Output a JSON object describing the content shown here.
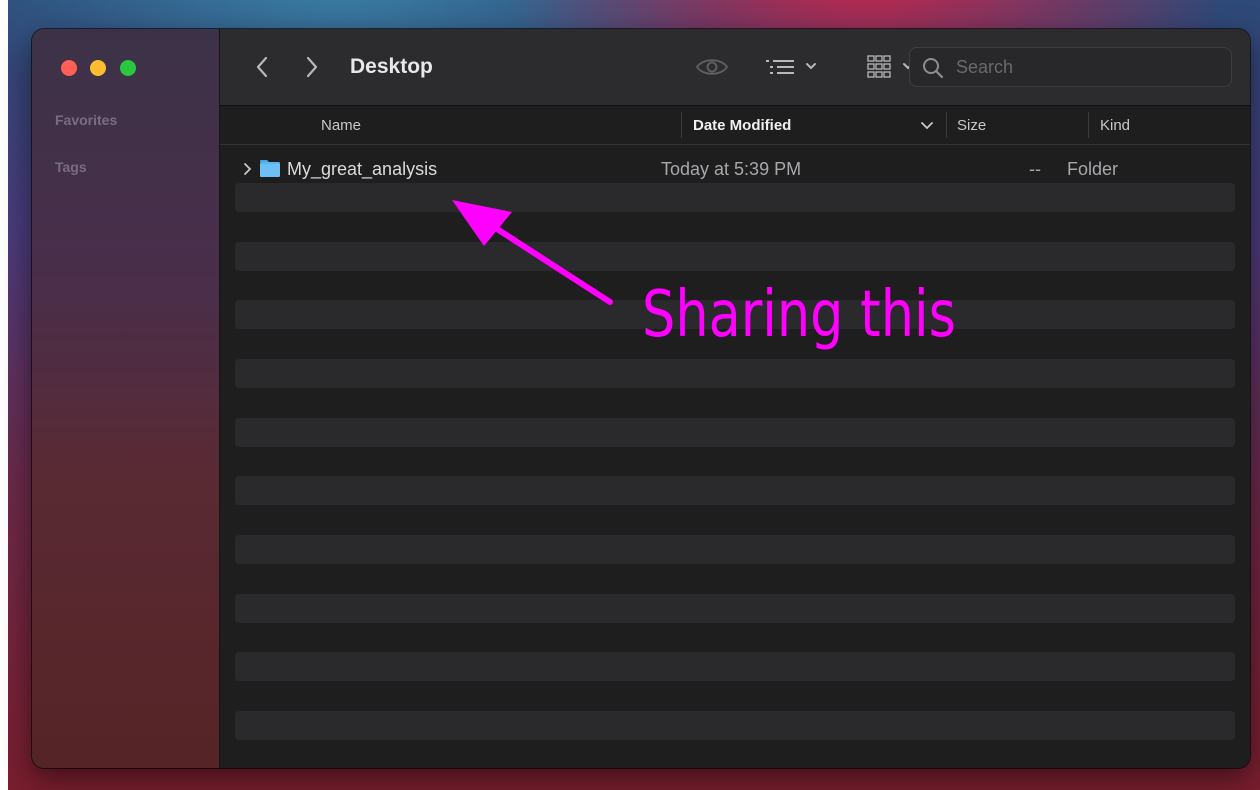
{
  "window": {
    "title": "Desktop"
  },
  "sidebar": {
    "sections": [
      {
        "label": "Favorites"
      },
      {
        "label": "Tags"
      }
    ]
  },
  "toolbar": {
    "back_icon": "chevron-left-icon",
    "forward_icon": "chevron-right-icon",
    "quicklook_icon": "eye-icon",
    "group_icon": "list-icon",
    "view_icon": "grid-icon",
    "search": {
      "placeholder": "Search",
      "value": ""
    }
  },
  "columns": [
    {
      "label": "Name"
    },
    {
      "label": "Date Modified",
      "sorted": true
    },
    {
      "label": "Size"
    },
    {
      "label": "Kind"
    }
  ],
  "files": [
    {
      "name": "My_great_analysis",
      "date_modified": "Today at 5:39 PM",
      "size": "--",
      "kind": "Folder",
      "icon": "folder-icon"
    }
  ],
  "annotation": {
    "text": "Sharing this",
    "color": "#ff00ff"
  },
  "colors": {
    "close": "#ff5f57",
    "minimize": "#febc2e",
    "zoom": "#28c840",
    "folder": "#5ab4f0"
  }
}
